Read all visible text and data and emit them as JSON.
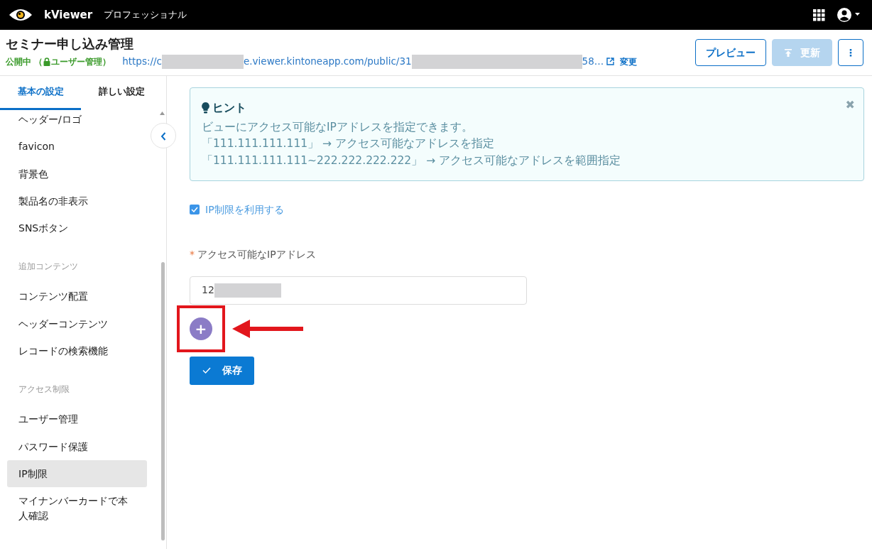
{
  "topbar": {
    "brand": "kViewer",
    "edition": "プロフェッショナル"
  },
  "header": {
    "title": "セミナー申し込み管理",
    "status": "公開中",
    "access": "（",
    "access_label": "ユーザー管理）",
    "url_parts": [
      {
        "kind": "text",
        "text": "https://c"
      },
      {
        "kind": "redacted"
      },
      {
        "kind": "text",
        "text": "e.viewer.kintoneapp.com/public/31"
      },
      {
        "kind": "redacted"
      },
      {
        "kind": "text",
        "text": "58…"
      }
    ],
    "change_link": "変更",
    "buttons": [
      {
        "kind": "outline",
        "label": "プレビュー",
        "disabled": false
      },
      {
        "kind": "upload",
        "label": "更新",
        "disabled": true
      },
      {
        "kind": "more",
        "label": "⋮",
        "disabled": false
      }
    ]
  },
  "sidebar": {
    "tabs": [
      {
        "label": "基本の設定",
        "selected": true
      },
      {
        "label": "詳しい設定",
        "selected": false
      }
    ],
    "groups": [
      {
        "items": [
          {
            "label": "ヘッダー/ロゴ",
            "selected": false
          },
          {
            "label": "favicon",
            "selected": false
          },
          {
            "label": "背景色",
            "selected": false
          },
          {
            "label": "製品名の非表示",
            "selected": false
          },
          {
            "label": "SNSボタン",
            "selected": false
          }
        ]
      },
      {
        "heading": "追加コンテンツ",
        "items": [
          {
            "label": "コンテンツ配置",
            "selected": false
          },
          {
            "label": "ヘッダーコンテンツ",
            "selected": false
          },
          {
            "label": "レコードの検索機能",
            "selected": false
          }
        ]
      },
      {
        "heading": "アクセス制限",
        "items": [
          {
            "label": "ユーザー管理",
            "selected": false
          },
          {
            "label": "パスワード保護",
            "selected": false
          },
          {
            "label": "IP制限",
            "selected": true
          },
          {
            "label": "マイナンバーカードで本人確認",
            "selected": false
          }
        ]
      }
    ]
  },
  "hint": {
    "title": "ヒント",
    "close": "✖",
    "lines": [
      "ビューにアクセス可能なIPアドレスを指定できます。",
      "「111.111.111.111」 → アクセス可能なアドレスを指定",
      "「111.111.111.111~222.222.222.222」 → アクセス可能なアドレスを範囲指定"
    ]
  },
  "ip_checkbox": {
    "label": "IP制限を利用する",
    "checked": true
  },
  "ip_field": {
    "required_mark": "*",
    "label": "アクセス可能なIPアドレス",
    "value": "12",
    "value_redacted": true
  },
  "add_button": {
    "label": "+"
  },
  "save_button": {
    "label": "保存"
  }
}
